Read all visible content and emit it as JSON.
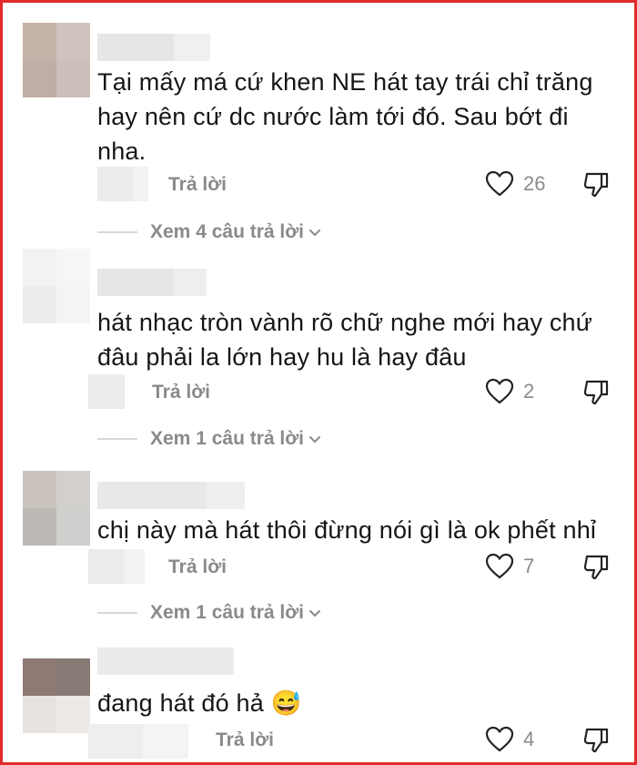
{
  "comments": [
    {
      "text": "Tại mấy má cứ khen NE hát tay trái chỉ trăng hay nên cứ dc nước làm tới đó. Sau bớt đi nha.",
      "reply_label": "Trả lời",
      "likes": "26",
      "view_replies": "Xem 4 câu trả lời"
    },
    {
      "text": "hát nhạc tròn vành rõ chữ nghe mới hay chứ đâu phải la lớn hay hu là hay đâu",
      "reply_label": "Trả lời",
      "likes": "2",
      "view_replies": "Xem 1 câu trả lời"
    },
    {
      "text": "chị này mà hát thôi đừng nói gì là ok phết nhỉ",
      "reply_label": "Trả lời",
      "likes": "7",
      "view_replies": "Xem 1 câu trả lời"
    },
    {
      "text": "đang hát đó hả 😅",
      "reply_label": "Trả lời",
      "likes": "4"
    }
  ],
  "colors": {
    "frame_border": "#e32b2b",
    "text": "#161616",
    "muted": "#8a8a8a"
  },
  "icons": {
    "like": "heart-outline-icon",
    "dislike": "thumbs-down-outline-icon",
    "expand": "chevron-down-icon"
  }
}
